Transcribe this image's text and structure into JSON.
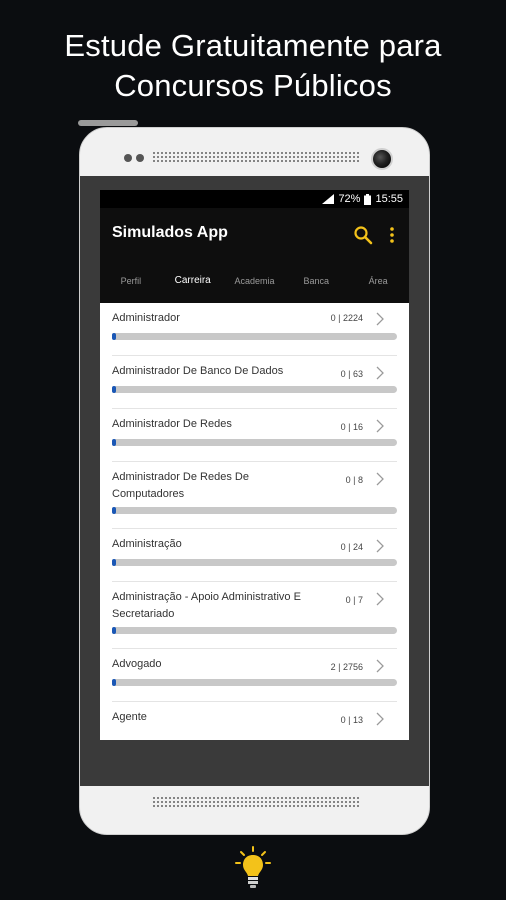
{
  "headline": {
    "line1": "Estude Gratuitamente para",
    "line2": "Concursos Públicos"
  },
  "status": {
    "battery": "72%",
    "time": "15:55"
  },
  "app": {
    "title": "Simulados App"
  },
  "tabs": [
    {
      "label": "Perfil",
      "active": false
    },
    {
      "label": "Carreira",
      "active": true
    },
    {
      "label": "Academia",
      "active": false
    },
    {
      "label": "Banca",
      "active": false
    },
    {
      "label": "Área",
      "active": false
    }
  ],
  "list": [
    {
      "name": "Administrador",
      "count": "0 | 2224",
      "progress": 0.01
    },
    {
      "name": "Administrador De Banco De Dados",
      "count": "0 | 63",
      "progress": 0.01
    },
    {
      "name": "Administrador De Redes",
      "count": "0 | 16",
      "progress": 0.01
    },
    {
      "name": "Administrador De Redes De Computadores",
      "count": "0 | 8",
      "progress": 0.01
    },
    {
      "name": "Administração",
      "count": "0 | 24",
      "progress": 0.01
    },
    {
      "name": "Administração - Apoio Administrativo E Secretariado",
      "count": "0 | 7",
      "progress": 0.01
    },
    {
      "name": "Advogado",
      "count": "2 | 2756",
      "progress": 0.01
    },
    {
      "name": "Agente",
      "count": "0 | 13",
      "progress": 0.01
    }
  ],
  "colors": {
    "accent": "#f3c21a",
    "progress": "#1a57b5"
  },
  "icons": {
    "search": "search-icon",
    "more": "more-vert-icon",
    "chevron": "chevron-right-icon",
    "bulb": "lightbulb-icon"
  }
}
